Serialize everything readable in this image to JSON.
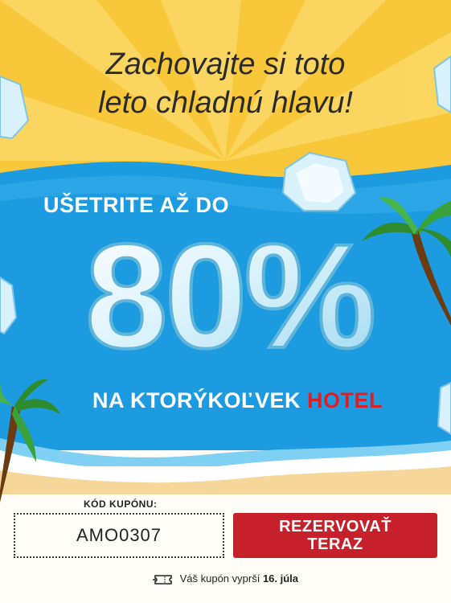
{
  "headline": {
    "line1": "Zachovajte si toto",
    "line2": "leto chladnú hlavu!"
  },
  "offer": {
    "save_prefix": "UŠETRITE AŽ DO",
    "discount": "80%",
    "target_prefix": "NA KTORÝKOĽVEK",
    "target_highlight": "HOTEL"
  },
  "coupon": {
    "label": "KÓD KUPÓNU:",
    "code": "AMO0307"
  },
  "cta": {
    "line1": "REZERVOVAŤ",
    "line2": "TERAZ"
  },
  "expiry": {
    "text": "Váš kupón vyprší",
    "date": "16. júla"
  },
  "colors": {
    "sky_yellow": "#f7c531",
    "sea_blue": "#1d9be0",
    "sand": "#f6d79a",
    "accent_red": "#d9202a",
    "button_red": "#c6202a",
    "ice": "#d8f1fb"
  },
  "icons": {
    "ticket": "ticket-icon",
    "palm_left": "palm-tree",
    "palm_right": "palm-tree",
    "ice": "ice-cube"
  }
}
